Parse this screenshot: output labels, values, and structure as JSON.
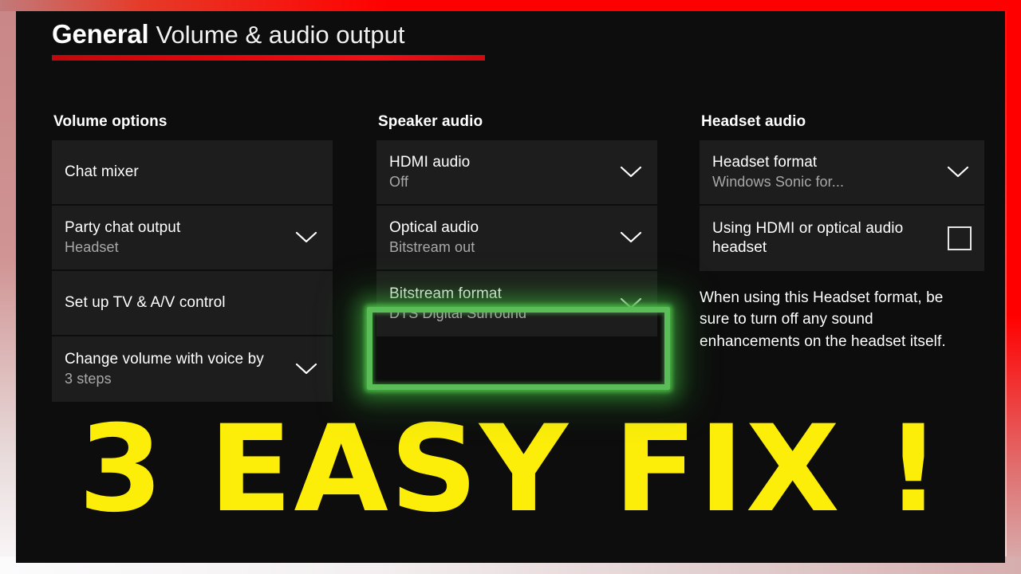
{
  "frame": {
    "accent_red": "#ff0000",
    "accent_yellow": "#fdee0a",
    "highlight_green": "#5bbd58"
  },
  "header": {
    "title": "General",
    "subtitle": "Volume & audio output"
  },
  "columns": {
    "volume": {
      "title": "Volume options",
      "tiles": [
        {
          "label": "Chat mixer",
          "value": "",
          "control": "none"
        },
        {
          "label": "Party chat output",
          "value": "Headset",
          "control": "chevron-down-icon"
        },
        {
          "label": "Set up TV & A/V control",
          "value": "",
          "control": "none"
        },
        {
          "label": "Change volume with voice by",
          "value": "3 steps",
          "control": "chevron-down-icon"
        }
      ]
    },
    "speaker": {
      "title": "Speaker audio",
      "tiles": [
        {
          "label": "HDMI audio",
          "value": "Off",
          "control": "chevron-down-icon"
        },
        {
          "label": "Optical audio",
          "value": "Bitstream out",
          "control": "chevron-down-icon"
        },
        {
          "label": "Bitstream format",
          "value": "DTS Digital Surround",
          "control": "chevron-down-icon"
        }
      ]
    },
    "headset": {
      "title": "Headset audio",
      "tiles": [
        {
          "label": "Headset format",
          "value": "Windows Sonic for...",
          "control": "chevron-down-icon"
        },
        {
          "label": "Using HDMI or optical audio headset",
          "value": "",
          "control": "checkbox"
        }
      ],
      "note": "When using this Headset format, be sure to turn off any sound enhancements on the headset itself."
    }
  },
  "caption": {
    "text": "3 EASY FIX !"
  }
}
